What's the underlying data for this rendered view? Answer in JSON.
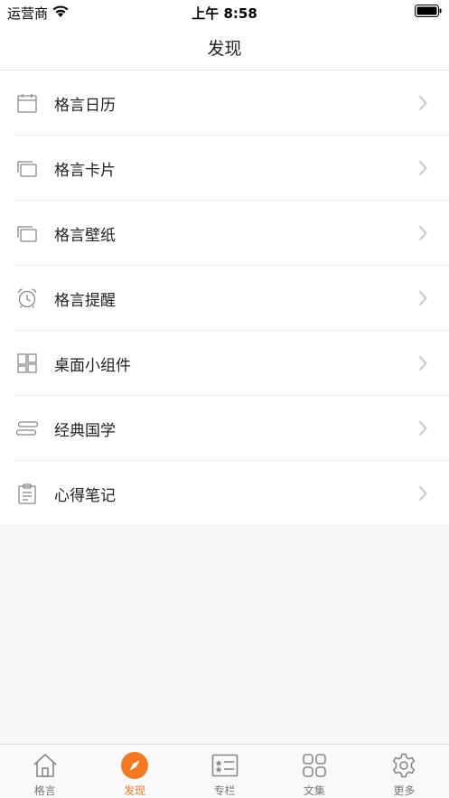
{
  "status_bar": {
    "carrier": "运营商",
    "time": "上午 8:58"
  },
  "nav": {
    "title": "发现"
  },
  "menu": [
    {
      "label": "格言日历",
      "icon": "calendar-icon"
    },
    {
      "label": "格言卡片",
      "icon": "cards-icon"
    },
    {
      "label": "格言壁纸",
      "icon": "wallpaper-icon"
    },
    {
      "label": "格言提醒",
      "icon": "alarm-clock-icon"
    },
    {
      "label": "桌面小组件",
      "icon": "widget-grid-icon"
    },
    {
      "label": "经典国学",
      "icon": "scroll-icon"
    },
    {
      "label": "心得笔记",
      "icon": "clipboard-icon"
    }
  ],
  "tabs": [
    {
      "label": "格言",
      "icon": "home-icon"
    },
    {
      "label": "发现",
      "icon": "compass-icon",
      "active": true
    },
    {
      "label": "专栏",
      "icon": "column-card-icon"
    },
    {
      "label": "文集",
      "icon": "grid-squares-icon"
    },
    {
      "label": "更多",
      "icon": "gear-icon"
    }
  ],
  "colors": {
    "accent": "#f37a22",
    "icon_gray": "#888888",
    "chevron": "#c4c4c4"
  }
}
